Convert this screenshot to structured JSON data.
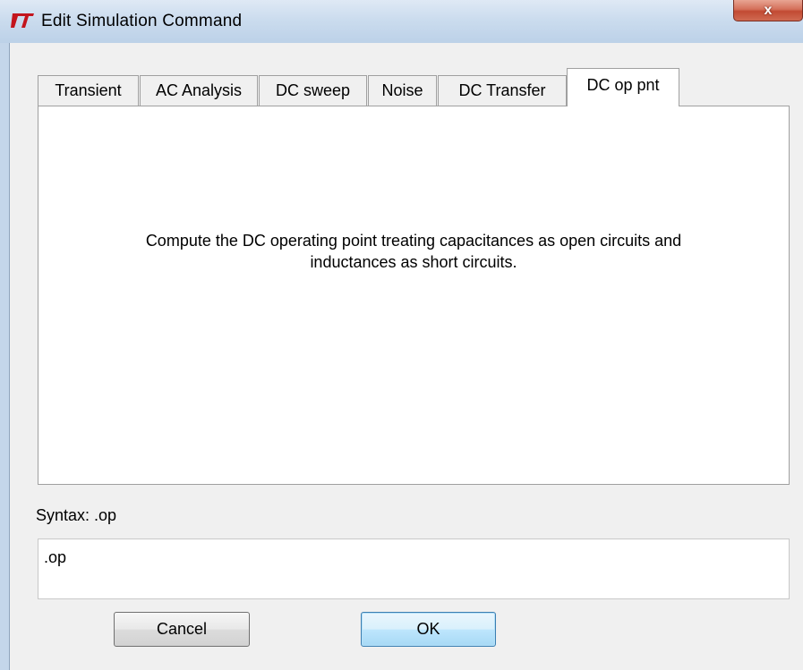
{
  "window": {
    "title": "Edit Simulation Command",
    "close_label": "x"
  },
  "tabs": [
    {
      "label": "Transient",
      "active": false
    },
    {
      "label": "AC Analysis",
      "active": false
    },
    {
      "label": "DC sweep",
      "active": false
    },
    {
      "label": "Noise",
      "active": false
    },
    {
      "label": "DC Transfer",
      "active": false
    },
    {
      "label": "DC op pnt",
      "active": true
    }
  ],
  "panel": {
    "description": "Compute the DC operating point treating capacitances as open circuits and\ninductances as short circuits."
  },
  "syntax": {
    "label": "Syntax:  .op"
  },
  "command": {
    "value": ".op"
  },
  "buttons": {
    "cancel_label": "Cancel",
    "ok_label": "OK"
  },
  "colors": {
    "app_icon": "#c3151d",
    "close_button": "#c24a33"
  },
  "icons": {
    "app": "lt-logo-icon",
    "close": "close-icon"
  }
}
